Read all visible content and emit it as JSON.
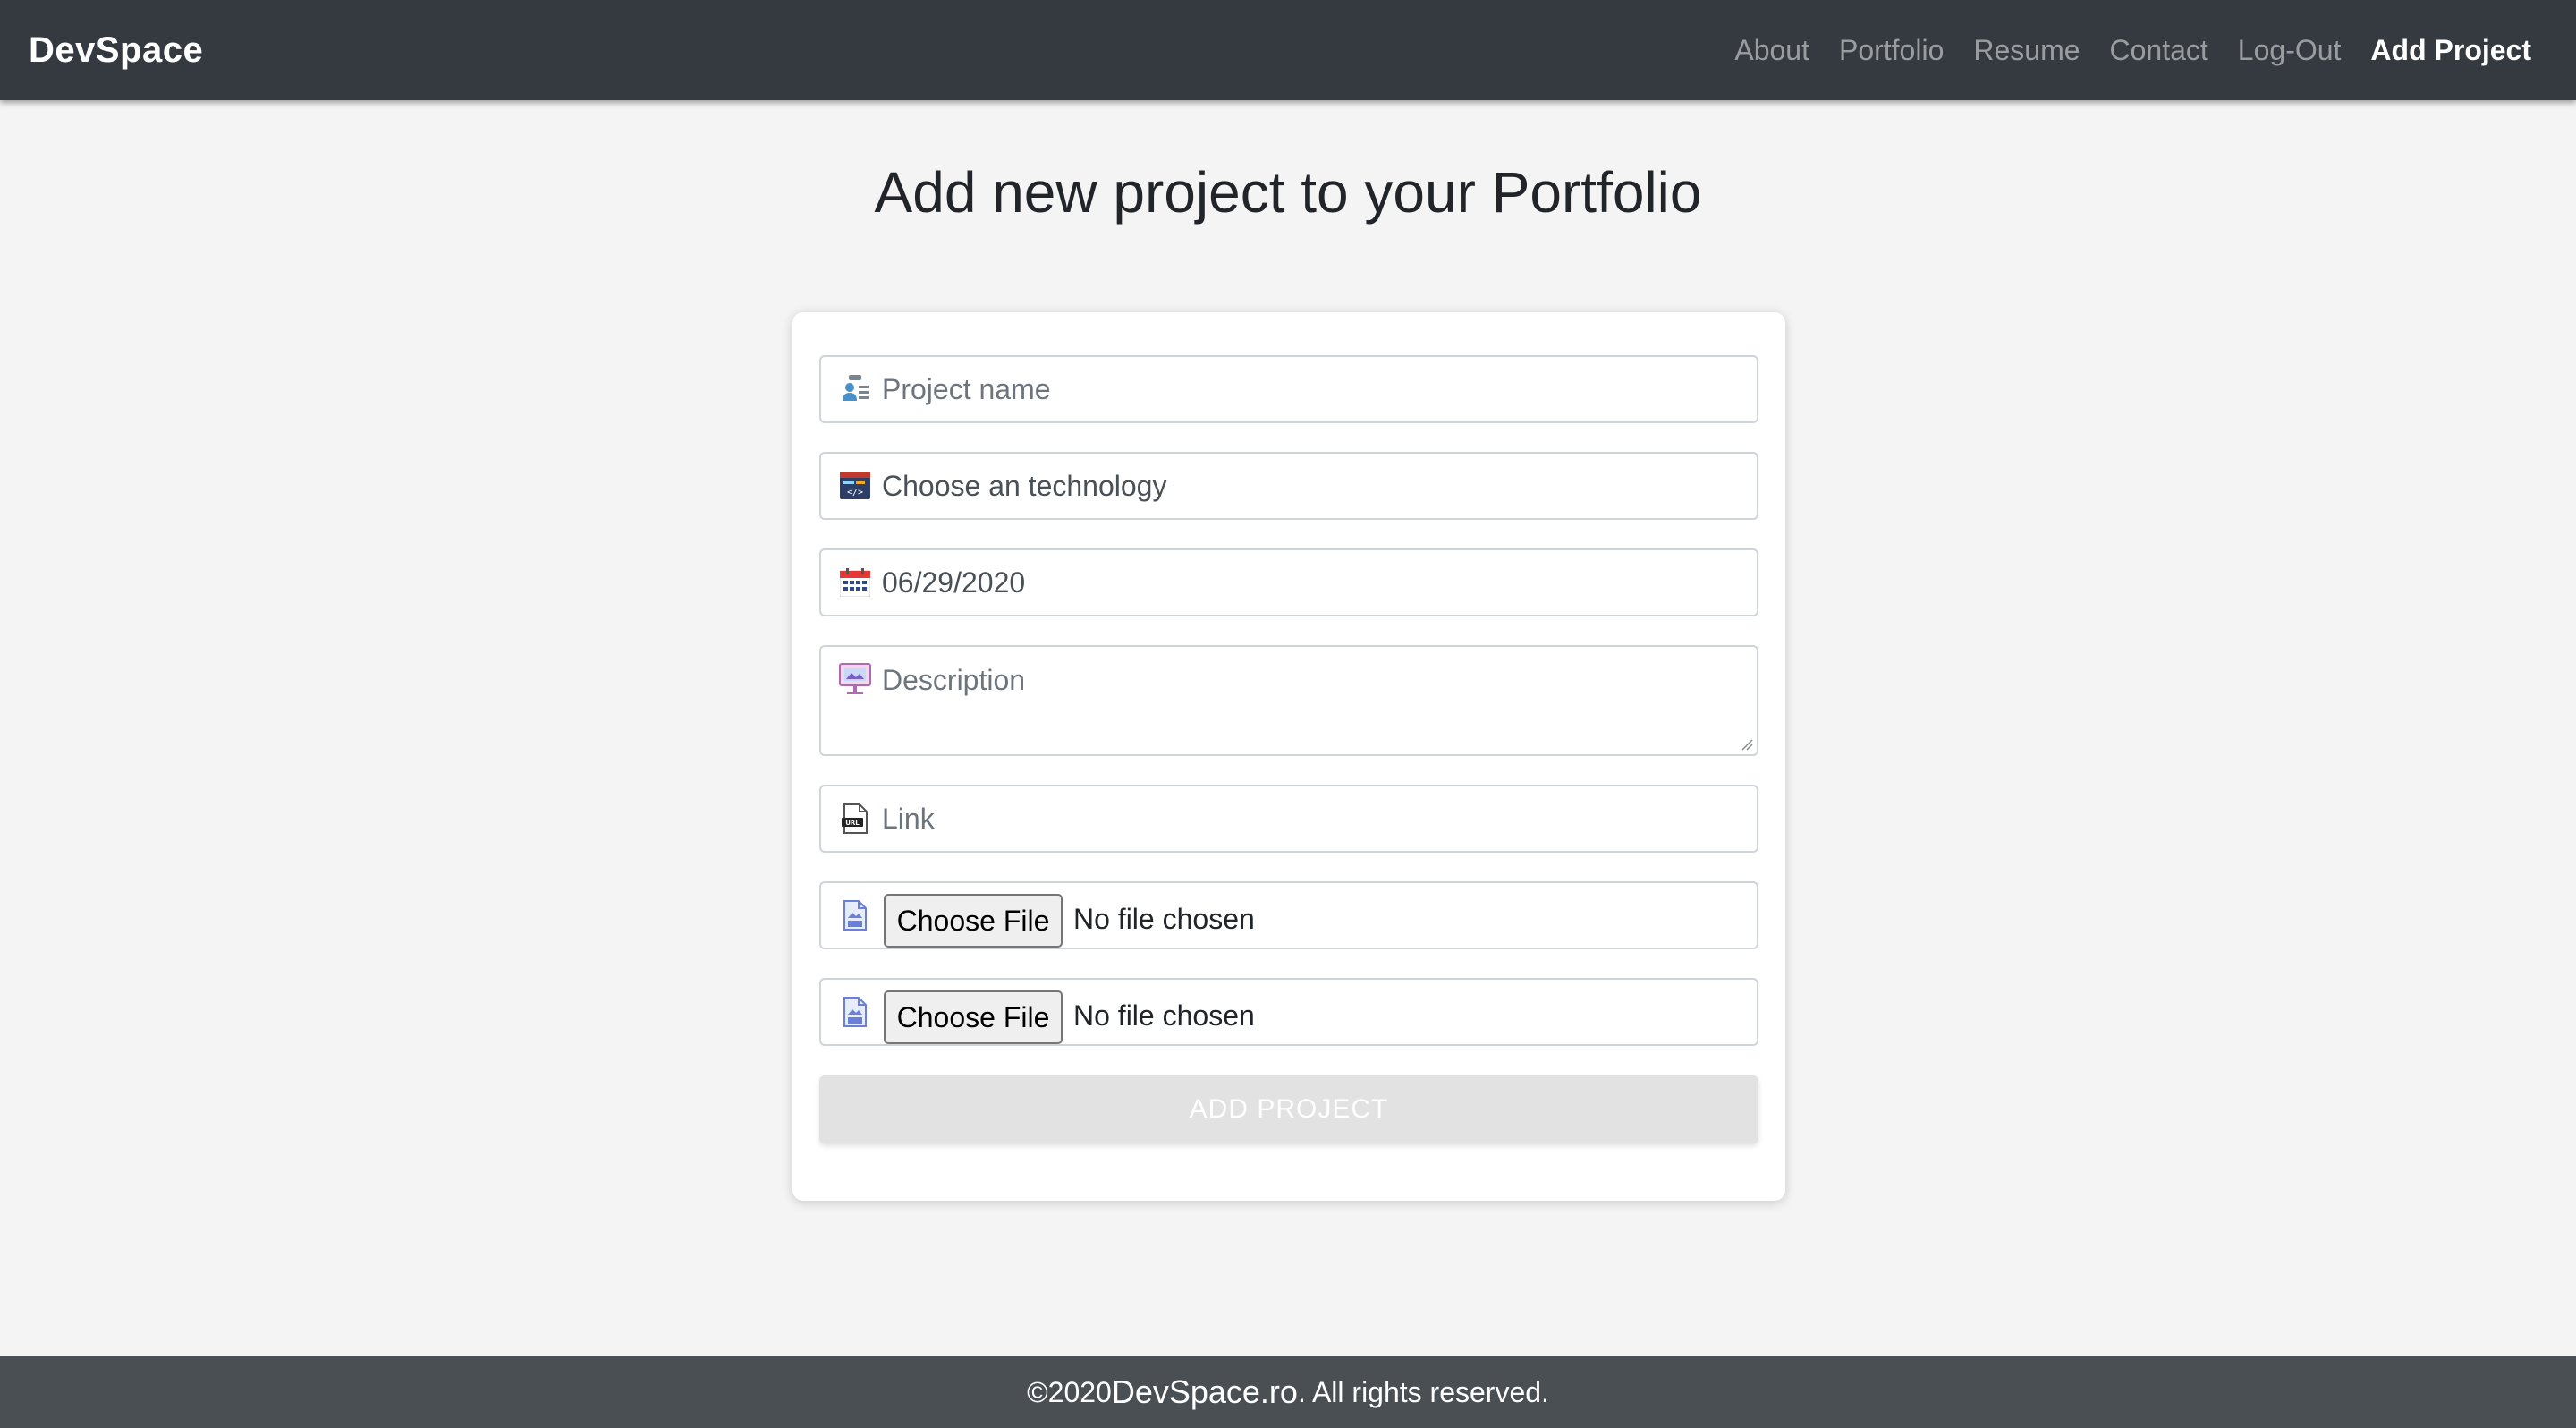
{
  "navbar": {
    "brand": "DevSpace",
    "links": [
      "About",
      "Portfolio",
      "Resume",
      "Contact",
      "Log-Out"
    ],
    "active_link": "Add Project",
    "bg_color": "#343a40"
  },
  "page": {
    "title": "Add new project to your Portfolio"
  },
  "form": {
    "project_name": {
      "placeholder": "Project name",
      "icon": "person-card-icon"
    },
    "technology": {
      "value": "Choose an technology",
      "icon": "code-window-icon"
    },
    "date": {
      "value": "06/29/2020",
      "icon": "calendar-icon"
    },
    "description": {
      "placeholder": "Description",
      "icon": "presentation-icon"
    },
    "link": {
      "placeholder": "Link",
      "icon": "url-file-icon"
    },
    "file_inputs": [
      {
        "button": "Choose File",
        "status": "No file chosen",
        "icon": "image-file-icon"
      },
      {
        "button": "Choose File",
        "status": "No file chosen",
        "icon": "image-file-icon"
      }
    ],
    "submit_label": "ADD PROJECT"
  },
  "footer": {
    "prefix": "©2020 ",
    "site": "DevSpace.ro",
    "suffix": ". All rights reserved."
  }
}
